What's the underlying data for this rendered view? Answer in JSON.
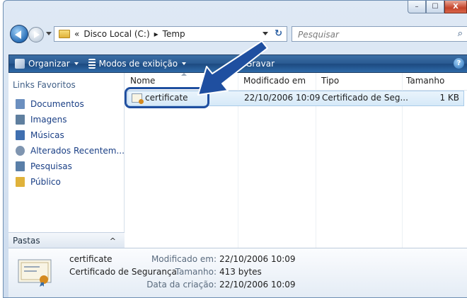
{
  "window": {
    "controls": {
      "minimize": "–",
      "maximize": "☐",
      "close": "X"
    }
  },
  "address": {
    "prefix": "«",
    "path": [
      "Disco Local (C:)",
      "Temp"
    ],
    "separator": "▸"
  },
  "search": {
    "placeholder": "Pesquisar"
  },
  "toolbar": {
    "organize": "Organizar",
    "views": "Modos de exibição",
    "burn": "Gravar",
    "help": "?"
  },
  "nav": {
    "heading": "Links Favoritos",
    "items": [
      {
        "label": "Documentos",
        "color": "#6b8fbf"
      },
      {
        "label": "Imagens",
        "color": "#5f7f9f"
      },
      {
        "label": "Músicas",
        "color": "#3f6fb0"
      },
      {
        "label": "Alterados Recentem...",
        "color": "#7f95b0"
      },
      {
        "label": "Pesquisas",
        "color": "#5a7fa8"
      },
      {
        "label": "Público",
        "color": "#e0b23a"
      }
    ],
    "folders": "Pastas"
  },
  "columns": [
    "Nome",
    "Modificado em",
    "Tipo",
    "Tamanho"
  ],
  "files": [
    {
      "name": "certificate",
      "modified": "22/10/2006 10:09",
      "type": "Certificado de Seg...",
      "size": "1 KB"
    }
  ],
  "details": {
    "name": "certificate",
    "type": "Certificado de Segurança",
    "modified_label": "Modificado em:",
    "modified": "22/10/2006 10:09",
    "size_label": "Tamanho:",
    "size": "413 bytes",
    "created_label": "Data da criação:",
    "created": "22/10/2006 10:09"
  }
}
